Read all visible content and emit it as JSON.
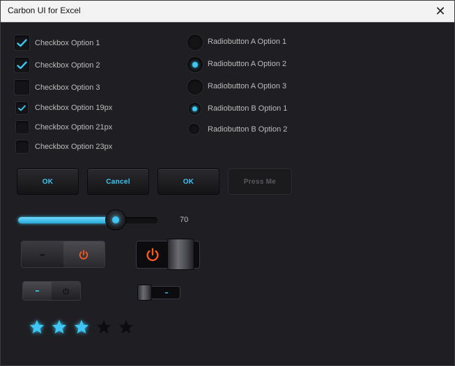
{
  "window": {
    "title": "Carbon UI for Excel",
    "close_glyph": "✕"
  },
  "checkboxes": [
    {
      "label": "Checkbox Option 1",
      "checked": true
    },
    {
      "label": "Checkbox Option 2",
      "checked": true
    },
    {
      "label": "Checkbox Option 3",
      "checked": false
    },
    {
      "label": "Checkbox Option 19px",
      "checked": true
    },
    {
      "label": "Checkbox Option 21px",
      "checked": false
    },
    {
      "label": "Checkbox Option 23px",
      "checked": false
    }
  ],
  "radios": [
    {
      "label": "Radiobutton A Option 1",
      "selected": false
    },
    {
      "label": "Radiobutton A Option 2",
      "selected": true
    },
    {
      "label": "Radiobutton A Option 3",
      "selected": false
    },
    {
      "label": "Radiobutton B Option 1",
      "selected": true
    },
    {
      "label": "Radiobutton B Option 2",
      "selected": false
    }
  ],
  "buttons": [
    {
      "label": "OK",
      "enabled": true
    },
    {
      "label": "Cancel",
      "enabled": true
    },
    {
      "label": "OK",
      "enabled": true
    },
    {
      "label": "Press Me",
      "enabled": false
    }
  ],
  "slider": {
    "value": "70",
    "fraction": 0.7
  },
  "toggles": {
    "toggle1": {
      "left_glyph": "–",
      "state": "on"
    },
    "toggle2": {
      "state": "off"
    },
    "toggle3": {
      "left_glyph": "–",
      "state": "on"
    },
    "toggle4": {
      "right_glyph": "–",
      "state": "off"
    }
  },
  "rating": {
    "value": 3,
    "max": 5
  },
  "colors": {
    "accent": "#3fc6f2",
    "power": "#ff5a1f",
    "background": "#1f1f23"
  }
}
